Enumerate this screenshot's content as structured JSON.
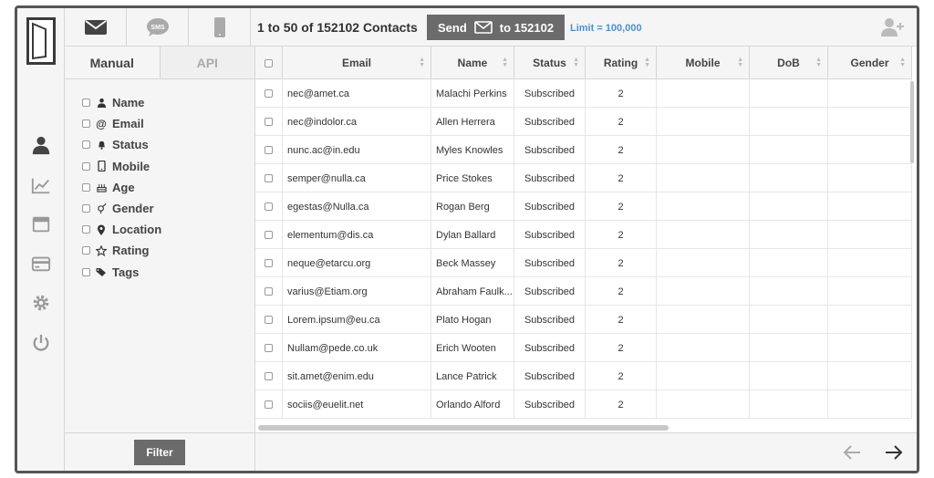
{
  "rail": {
    "icons": [
      "logo-door-icon",
      "user-icon",
      "chart-icon",
      "window-icon",
      "credit-card-icon",
      "gear-icon",
      "power-icon"
    ]
  },
  "topbar": {
    "channels": [
      "email-icon",
      "sms-icon",
      "mobile-icon"
    ],
    "count_text": "1 to 50 of 152102 Contacts",
    "send_label": "Send",
    "send_target": "to 152102",
    "limit_text": "Limit = 100,000"
  },
  "panel": {
    "tabs": [
      "Manual",
      "API"
    ],
    "filters": [
      {
        "label": "Name",
        "icon": "user-icon"
      },
      {
        "label": "Email",
        "icon": "at-icon"
      },
      {
        "label": "Status",
        "icon": "bell-icon"
      },
      {
        "label": "Mobile",
        "icon": "mobile-icon"
      },
      {
        "label": "Age",
        "icon": "cake-icon"
      },
      {
        "label": "Gender",
        "icon": "gender-icon"
      },
      {
        "label": "Location",
        "icon": "map-pin-icon"
      },
      {
        "label": "Rating",
        "icon": "star-icon"
      },
      {
        "label": "Tags",
        "icon": "tags-icon"
      }
    ],
    "filter_button": "Filter"
  },
  "table": {
    "columns": [
      "Email",
      "Name",
      "Status",
      "Rating",
      "Mobile",
      "DoB",
      "Gender"
    ],
    "rows": [
      {
        "email": "nec@amet.ca",
        "name": "Malachi Perkins",
        "status": "Subscribed",
        "rating": "2"
      },
      {
        "email": "nec@indolor.ca",
        "name": "Allen Herrera",
        "status": "Subscribed",
        "rating": "2"
      },
      {
        "email": "nunc.ac@in.edu",
        "name": "Myles Knowles",
        "status": "Subscribed",
        "rating": "2"
      },
      {
        "email": "semper@nulla.ca",
        "name": "Price Stokes",
        "status": "Subscribed",
        "rating": "2"
      },
      {
        "email": "egestas@Nulla.ca",
        "name": "Rogan Berg",
        "status": "Subscribed",
        "rating": "2"
      },
      {
        "email": "elementum@dis.ca",
        "name": "Dylan Ballard",
        "status": "Subscribed",
        "rating": "2"
      },
      {
        "email": "neque@etarcu.org",
        "name": "Beck Massey",
        "status": "Subscribed",
        "rating": "2"
      },
      {
        "email": "varius@Etiam.org",
        "name": "Abraham Faulk...",
        "status": "Subscribed",
        "rating": "2"
      },
      {
        "email": "Lorem.ipsum@eu.ca",
        "name": "Plato Hogan",
        "status": "Subscribed",
        "rating": "2"
      },
      {
        "email": "Nullam@pede.co.uk",
        "name": "Erich Wooten",
        "status": "Subscribed",
        "rating": "2"
      },
      {
        "email": "sit.amet@enim.edu",
        "name": "Lance Patrick",
        "status": "Subscribed",
        "rating": "2"
      },
      {
        "email": "sociis@euelit.net",
        "name": "Orlando Alford",
        "status": "Subscribed",
        "rating": "2"
      }
    ]
  },
  "pagination": {
    "prev_icon": "arrow-left-icon",
    "next_icon": "arrow-right-icon"
  },
  "colors": {
    "button_bg": "#6b6b6b",
    "limit_text": "#4a90d9",
    "border": "#555555"
  }
}
